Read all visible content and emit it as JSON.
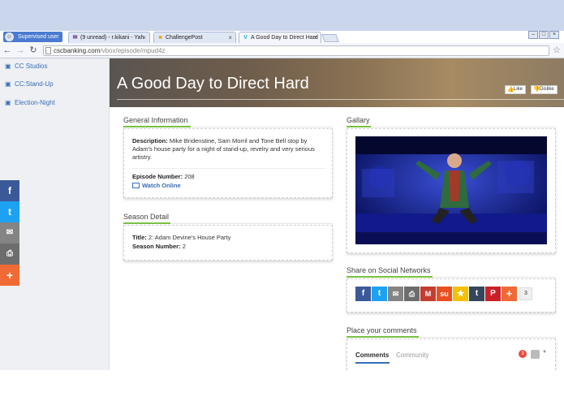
{
  "browser": {
    "supervised_label": "Supervised user",
    "tabs": [
      {
        "label": "(9 unread) - r.kikani - Yah",
        "close": "×"
      },
      {
        "label": "ChallengePost",
        "close": "×"
      },
      {
        "label": "A Good Day to Direct Hard",
        "close": "×"
      }
    ],
    "url_domain": "cscbanking.com",
    "url_path": "/vbox/episode/mpud4z"
  },
  "sidebar": {
    "items": [
      {
        "label": "CC Studios"
      },
      {
        "label": "CC:Stand-Up"
      },
      {
        "label": "Election-Night"
      }
    ]
  },
  "floating_share": [
    "f",
    "t",
    "✉",
    "⎙",
    "+"
  ],
  "hero": {
    "title": "A Good Day to Direct Hard",
    "like_label": "Like",
    "dislike_label": "Dislike"
  },
  "general": {
    "heading": "General Information",
    "description_label": "Description:",
    "description": "Mike Bridenstine, Sam Morril and Tone Bell stop by Adam's house party for a night of stand-up, revelry and very serious artistry.",
    "episode_label": "Episode Number:",
    "episode_number": "208",
    "watch_label": "Watch Online"
  },
  "season": {
    "heading": "Season Detail",
    "title_label": "Title:",
    "title": "2: Adam Devine's House Party",
    "season_label": "Season Number:",
    "season_number": "2"
  },
  "gallery": {
    "heading": "Gallary"
  },
  "share": {
    "heading": "Share on Social Networks",
    "count": "3",
    "colors": [
      "#3b5998",
      "#1da1f2",
      "#848484",
      "#6d6d6d",
      "#c43d2f",
      "#e94f1f",
      "#f5c000",
      "#35465c",
      "#cb2027",
      "#f06a35"
    ]
  },
  "comments": {
    "heading": "Place your comments",
    "tab_comments": "Comments",
    "tab_community": "Community",
    "notification_count": "3"
  },
  "colors": {
    "accent_green": "#7ac143",
    "link_blue": "#3a6eb5"
  }
}
